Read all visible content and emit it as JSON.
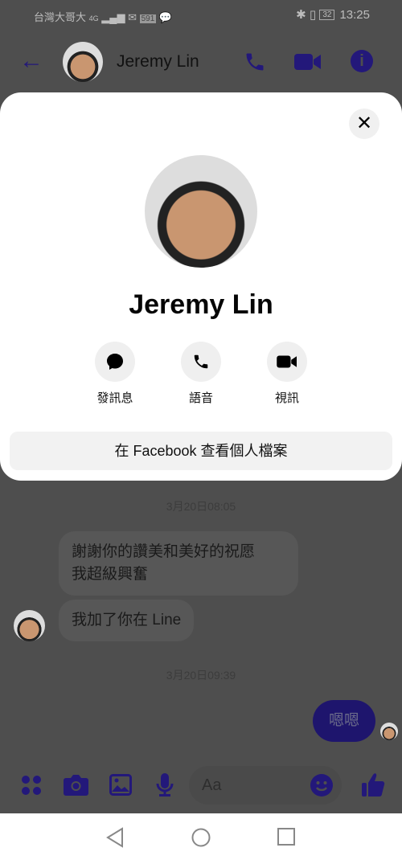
{
  "status_bar": {
    "carrier": "台灣大哥大",
    "network": "4G",
    "notif_badge": "591",
    "battery": "32",
    "time": "13:25"
  },
  "header": {
    "contact_name": "Jeremy Lin",
    "icons": [
      "back-arrow-icon",
      "phone-icon",
      "video-icon",
      "info-icon"
    ]
  },
  "modal": {
    "name": "Jeremy Lin",
    "actions": [
      {
        "label": "發訊息",
        "icon": "message-icon"
      },
      {
        "label": "語音",
        "icon": "phone-icon"
      },
      {
        "label": "視訊",
        "icon": "video-icon"
      }
    ],
    "profile_button": "在 Facebook 查看個人檔案"
  },
  "chat": {
    "timestamps": [
      "3月20日08:05",
      "3月20日09:39"
    ],
    "received": [
      "謝謝你的讚美和美好的祝愿\n我超級興奮",
      "我加了你在 Line"
    ],
    "sent": [
      "嗯嗯"
    ]
  },
  "composer": {
    "placeholder": "Aa"
  },
  "colors": {
    "accent": "#1e156d",
    "overlay": "#4e4e4e"
  }
}
